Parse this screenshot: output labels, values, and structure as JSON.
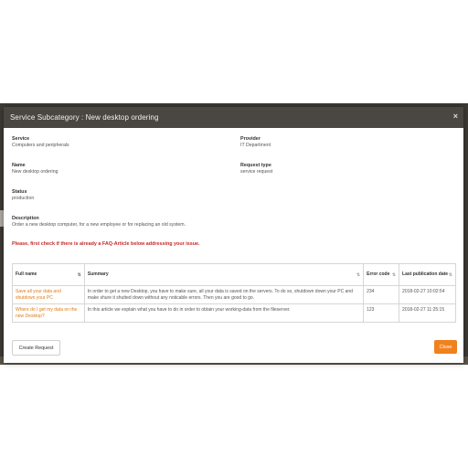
{
  "modal": {
    "title": "Service Subcategory : New desktop ordering",
    "close_icon": "×"
  },
  "details": {
    "service": {
      "label": "Service",
      "value": "Computers and peripherals"
    },
    "provider": {
      "label": "Provider",
      "value": "IT Department"
    },
    "name": {
      "label": "Name",
      "value": "New desktop ordering"
    },
    "request_type": {
      "label": "Request type",
      "value": "service request"
    },
    "status": {
      "label": "Status",
      "value": "production"
    },
    "description": {
      "label": "Description",
      "value": "Order a new desktop computer, for a new employee or for replacing an old system."
    }
  },
  "warning": "Please, first check if there is already a FAQ-Article below addressing your issue.",
  "table": {
    "columns": [
      "Full name",
      "Summary",
      "Error code",
      "Last publication date"
    ],
    "rows": [
      {
        "full_name": "Save all your data and shutdown your PC",
        "summary": "In order to get a new Desktop, you have to make sure, all your data is saved on the servers. To do so, shutdown down your PC and make shure it shutted down without any noticable errors. Then you are good to go.",
        "error_code": "234",
        "date": "2018-02-27 10:02:54"
      },
      {
        "full_name": "Where do I get my data on the new Desktop?",
        "summary": "In this article we explain what you have to do in order to obtain your working-data from the fileserver.",
        "error_code": "123",
        "date": "2018-02-27 11:25:15"
      }
    ]
  },
  "buttons": {
    "create_request": "Create Request",
    "close": "Close"
  },
  "colors": {
    "header_bg": "#4a4641",
    "accent": "#f0821e",
    "link": "#e07a13",
    "warning": "#c62828"
  }
}
